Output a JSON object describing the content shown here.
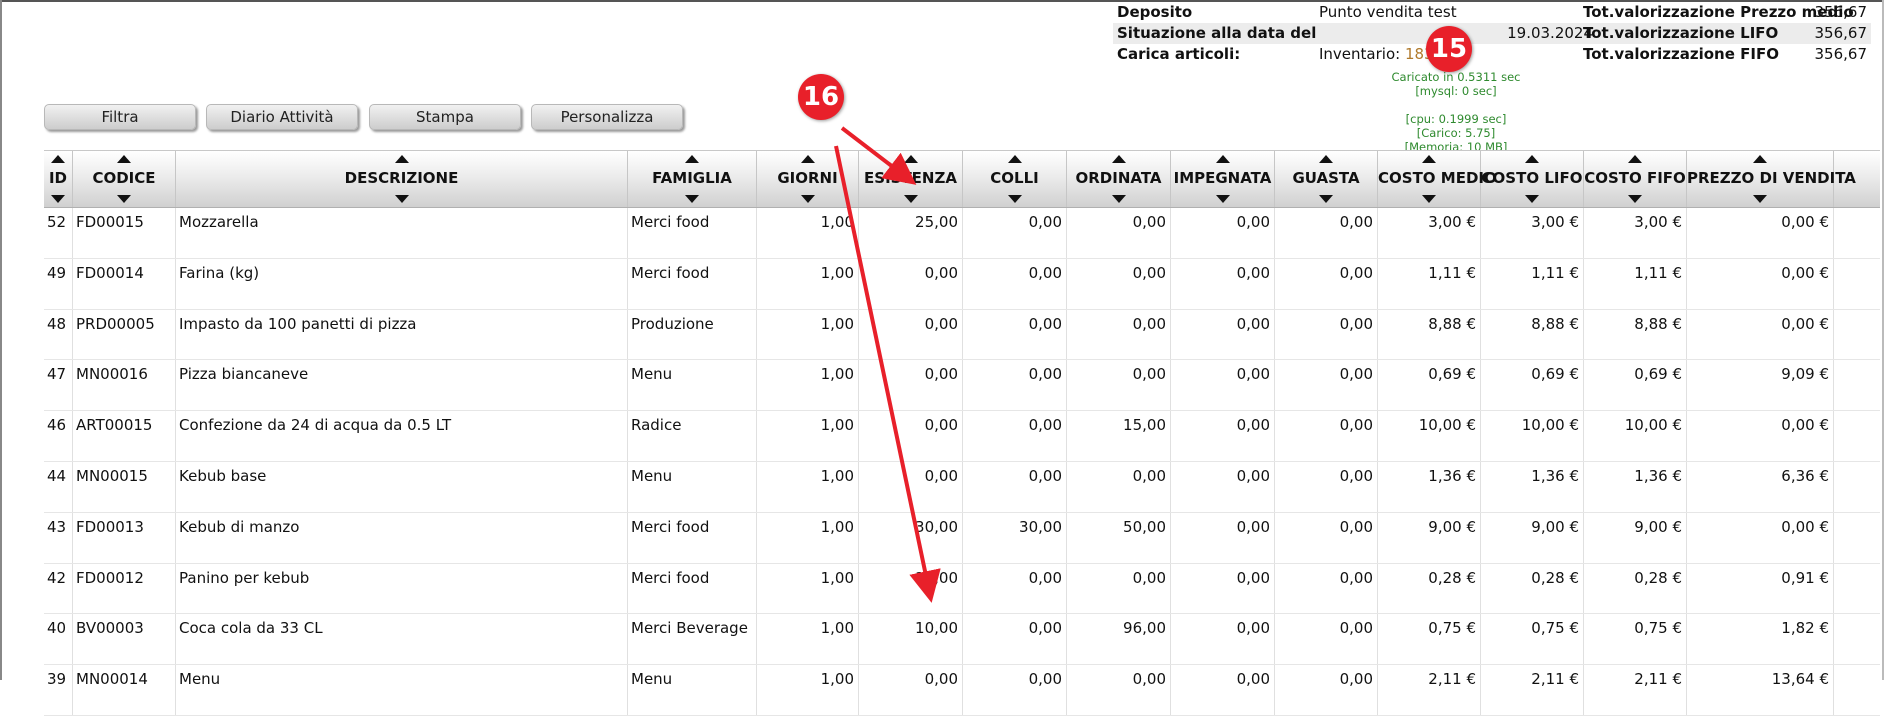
{
  "summary": {
    "deposit_label": "Deposito",
    "deposit_value": "Punto vendita test",
    "date_label": "Situazione alla data del",
    "date_value": "19.03.2024",
    "load_label": "Carica articoli:",
    "inventory_label": "Inventario:",
    "inventory_count": "183",
    "tot_medio_label": "Tot.valorizzazione Prezzo medio",
    "tot_medio_value": "356,67",
    "tot_lifo_label": "Tot.valorizzazione LIFO",
    "tot_lifo_value": "356,67",
    "tot_fifo_label": "Tot.valorizzazione FIFO",
    "tot_fifo_value": "356,67"
  },
  "perf": {
    "line1": "Caricato in 0.5311 sec",
    "line2": "[mysql: 0 sec]",
    "line3": "",
    "line4": "[cpu: 0.1999 sec]",
    "line5": "[Carico: 5.75]",
    "line6": "[Memoria: 10 MB]"
  },
  "toolbar": {
    "filter": "Filtra",
    "activity_log": "Diario Attività",
    "print": "Stampa",
    "customize": "Personalizza"
  },
  "columns": [
    "ID",
    "CODICE",
    "DESCRIZIONE",
    "FAMIGLIA",
    "GIORNI",
    "ESISTENZA",
    "COLLI",
    "ORDINATA",
    "IMPEGNATA",
    "GUASTA",
    "COSTO MEDIO",
    "COSTO LIFO",
    "COSTO FIFO",
    "PREZZO DI VENDITA"
  ],
  "rows": [
    [
      "52",
      "FD00015",
      "Mozzarella",
      "Merci food",
      "1,00",
      "25,00",
      "0,00",
      "0,00",
      "0,00",
      "0,00",
      "3,00 €",
      "3,00 €",
      "3,00 €",
      "0,00 €"
    ],
    [
      "49",
      "FD00014",
      "Farina (kg)",
      "Merci food",
      "1,00",
      "0,00",
      "0,00",
      "0,00",
      "0,00",
      "0,00",
      "1,11 €",
      "1,11 €",
      "1,11 €",
      "0,00 €"
    ],
    [
      "48",
      "PRD00005",
      "Impasto da 100 panetti di pizza",
      "Produzione",
      "1,00",
      "0,00",
      "0,00",
      "0,00",
      "0,00",
      "0,00",
      "8,88 €",
      "8,88 €",
      "8,88 €",
      "0,00 €"
    ],
    [
      "47",
      "MN00016",
      "Pizza biancaneve",
      "Menu",
      "1,00",
      "0,00",
      "0,00",
      "0,00",
      "0,00",
      "0,00",
      "0,69 €",
      "0,69 €",
      "0,69 €",
      "9,09 €"
    ],
    [
      "46",
      "ART00015",
      "Confezione da 24 di acqua da 0.5 LT",
      "Radice",
      "1,00",
      "0,00",
      "0,00",
      "15,00",
      "0,00",
      "0,00",
      "10,00 €",
      "10,00 €",
      "10,00 €",
      "0,00 €"
    ],
    [
      "44",
      "MN00015",
      "Kebub base",
      "Menu",
      "1,00",
      "0,00",
      "0,00",
      "0,00",
      "0,00",
      "0,00",
      "1,36 €",
      "1,36 €",
      "1,36 €",
      "6,36 €"
    ],
    [
      "43",
      "FD00013",
      "Kebub di manzo",
      "Merci food",
      "1,00",
      "30,00",
      "30,00",
      "50,00",
      "0,00",
      "0,00",
      "9,00 €",
      "9,00 €",
      "9,00 €",
      "0,00 €"
    ],
    [
      "42",
      "FD00012",
      "Panino per kebub",
      "Merci food",
      "1,00",
      "15,00",
      "0,00",
      "0,00",
      "0,00",
      "0,00",
      "0,28 €",
      "0,28 €",
      "0,28 €",
      "0,91 €"
    ],
    [
      "40",
      "BV00003",
      "Coca cola da 33 CL",
      "Merci Beverage",
      "1,00",
      "10,00",
      "0,00",
      "96,00",
      "0,00",
      "0,00",
      "0,75 €",
      "0,75 €",
      "0,75 €",
      "1,82 €"
    ],
    [
      "39",
      "MN00014",
      "Menu",
      "Menu",
      "1,00",
      "0,00",
      "0,00",
      "0,00",
      "0,00",
      "0,00",
      "2,11 €",
      "2,11 €",
      "2,11 €",
      "13,64 €"
    ]
  ],
  "annotations": {
    "badge_a": "15",
    "badge_b": "16"
  },
  "colors": {
    "badge": "#e8202a",
    "perf_text": "#2e8a2e",
    "inventory_count": "#b07a2c"
  }
}
